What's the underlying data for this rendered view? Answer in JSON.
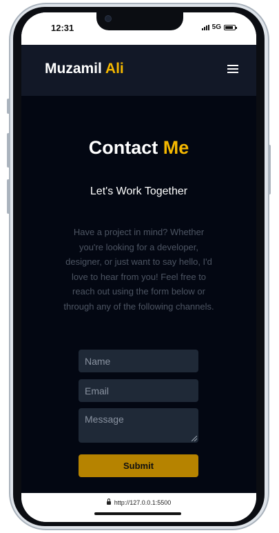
{
  "status_bar": {
    "time": "12:31",
    "network": "5G"
  },
  "header": {
    "logo_first": "Muzamil",
    "logo_accent": "Ali",
    "menu_icon": "hamburger-menu-icon"
  },
  "contact": {
    "title_main": "Contact",
    "title_accent": "Me",
    "subtitle": "Let's Work Together",
    "intro": "Have a project in mind? Whether you're looking for a developer, designer, or just want to say hello, I'd love to hear from you! Feel free to reach out using the form below or through any of the following channels."
  },
  "form": {
    "name_placeholder": "Name",
    "email_placeholder": "Email",
    "message_placeholder": "Message",
    "submit_label": "Submit"
  },
  "url_bar": {
    "url": "http://127.0.0.1:5500"
  },
  "colors": {
    "accent": "#f5b800",
    "button": "#b68300",
    "background": "#030712",
    "header": "#121827",
    "field": "#1f2937"
  }
}
